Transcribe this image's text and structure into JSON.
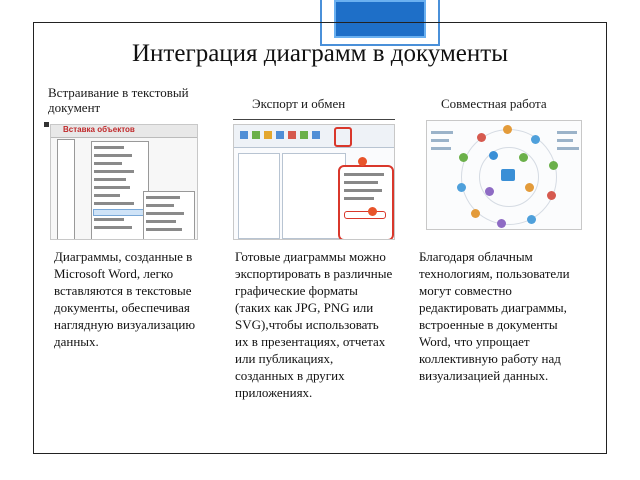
{
  "slide": {
    "title": "Интеграция диаграмм в документы"
  },
  "columns": [
    {
      "heading": "Встраивание в текстовый документ",
      "screenshot_label": "Вставка объектов",
      "text": "Диаграммы, созданные в Microsoft Word, легко вставляются в текстовые документы, обеспечивая наглядную визуализацию данных."
    },
    {
      "heading": "Экспорт и обмен",
      "text": "Готовые диаграммы можно экспортировать в различные графические форматы (таких как JPG, PNG или SVG),чтобы использовать их в презентациях, отчетах или публикациях, созданных в других приложениях."
    },
    {
      "heading": "Совместная работа",
      "text": "Благодаря облачным технологиям, пользователи могут совместно редактировать диаграммы, встроенные в документы Word, что упрощает коллективную работу над визуализацией данных."
    }
  ],
  "colors": {
    "accent_blue": "#1e6fc8",
    "frame": "#222222",
    "highlight_red": "#d9372b"
  }
}
